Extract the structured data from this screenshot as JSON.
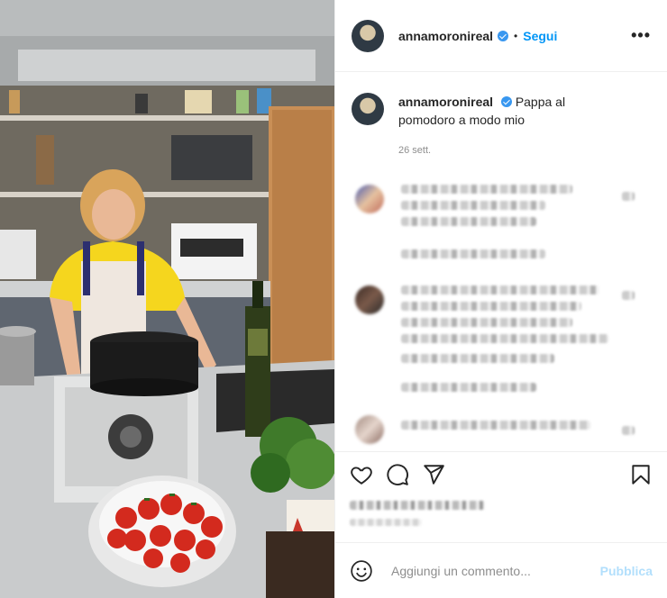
{
  "post": {
    "username": "annamoronireal",
    "separator": "•",
    "follow_label": "Segui",
    "more_label": "•••",
    "caption_text": "Pappa al pomodoro a modo mio",
    "time_ago": "26 sett."
  },
  "actions": {
    "like_icon": "heart-icon",
    "comment_icon": "comment-bubble-icon",
    "share_icon": "paper-plane-icon",
    "save_icon": "bookmark-icon"
  },
  "add_comment": {
    "placeholder": "Aggiungi un commento...",
    "publish_label": "Pubblica"
  },
  "colors": {
    "accent": "#0095f6",
    "verified": "#3897f0",
    "publish_disabled": "#b2dffc",
    "muted": "#8e8e8e"
  }
}
